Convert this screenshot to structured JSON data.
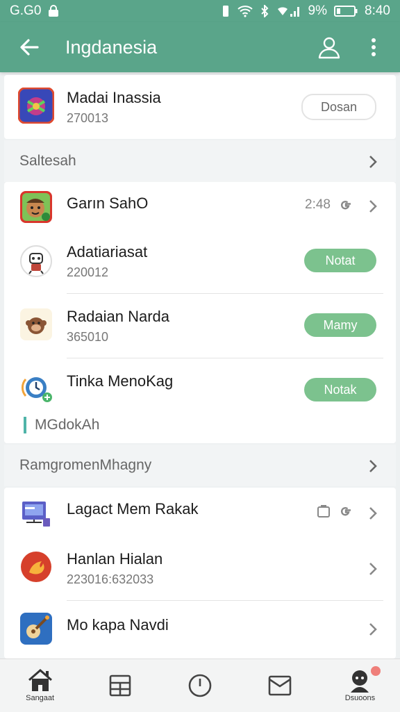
{
  "status_bar": {
    "left_text": "G.G0",
    "battery": "9%",
    "time": "8:40",
    "icons": [
      "lock-icon",
      "vibrate-icon",
      "wifi-icon",
      "bluetooth-icon",
      "signal-icon",
      "battery-icon"
    ]
  },
  "app_bar": {
    "title": "Ingdanesia",
    "back_icon": "arrow-left-icon",
    "actions": [
      "user-icon",
      "more-vert-icon"
    ]
  },
  "featured": {
    "name": "Madai Inassia",
    "sub": "270013",
    "button": "Dosan"
  },
  "section1": {
    "label": "Saltesah"
  },
  "list1": [
    {
      "name": "Garın SahO",
      "sub": "",
      "meta": "2:48",
      "has_g": true
    },
    {
      "name": "Adatiariasat",
      "sub": "220012",
      "button": "Notat"
    },
    {
      "name": "Radaian Narda",
      "sub": "365010",
      "button": "Mamy"
    },
    {
      "name": "Tinka MenoKag",
      "sub": "",
      "button": "Notak"
    }
  ],
  "subheader": {
    "label": "MGdokAh"
  },
  "section2": {
    "label": "RamgromenMhagny"
  },
  "list2": [
    {
      "name": "Lagact Mem Rakak",
      "sub": ""
    },
    {
      "name": "Hanlan Hialan",
      "sub": "223016:632033"
    },
    {
      "name": "Mo kapa Navdi",
      "sub": ""
    }
  ],
  "bottom_nav": [
    {
      "label": "Sangaat",
      "icon": "home-icon"
    },
    {
      "label": "",
      "icon": "grid-icon"
    },
    {
      "label": "",
      "icon": "clock-icon"
    },
    {
      "label": "",
      "icon": "inbox-icon"
    },
    {
      "label": "Dsuoons",
      "icon": "profile-icon"
    }
  ],
  "colors": {
    "primary": "#5aa58a",
    "pill": "#7cc28e",
    "accent_bar": "#4fb4a8",
    "badge": "#ef7f7a"
  }
}
